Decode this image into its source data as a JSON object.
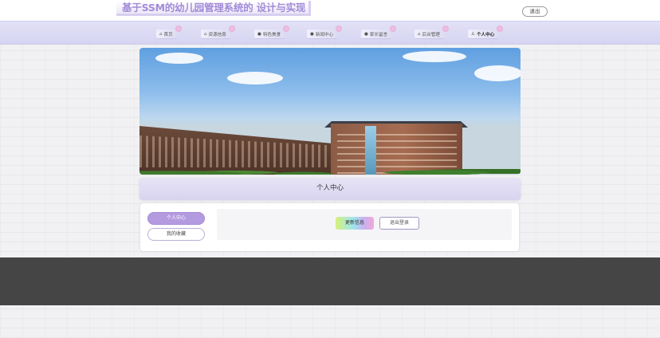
{
  "header": {
    "site_title": "基于SSM的幼儿园管理系统的 设计与实现",
    "logout_label": "退出"
  },
  "nav": {
    "items": [
      {
        "label": "首页",
        "icon": "home-icon",
        "glyph": "⌂"
      },
      {
        "label": "资源信息",
        "icon": "resource-icon",
        "glyph": "⌂"
      },
      {
        "label": "特色美食",
        "icon": "food-icon",
        "glyph": "●"
      },
      {
        "label": "新闻中心",
        "icon": "news-icon",
        "glyph": "●"
      },
      {
        "label": "家长留言",
        "icon": "message-icon",
        "glyph": "●"
      },
      {
        "label": "后台管理",
        "icon": "admin-icon",
        "glyph": "⌂"
      },
      {
        "label": "个人中心",
        "icon": "user-icon",
        "glyph": "♙",
        "active": true
      }
    ]
  },
  "banner": {
    "slide_count": 3,
    "active_slide": 2
  },
  "section": {
    "title": "个人中心"
  },
  "sidebar": {
    "items": [
      {
        "label": "个人中心",
        "active": true
      },
      {
        "label": "我的收藏",
        "active": false
      }
    ]
  },
  "actions": {
    "update_label": "更新信息",
    "logout_label": "退出登录"
  },
  "colors": {
    "accent": "#b49be0",
    "nav_bg": "#d6d4f1",
    "title_text": "#a28bd8",
    "footer": "#454545"
  }
}
